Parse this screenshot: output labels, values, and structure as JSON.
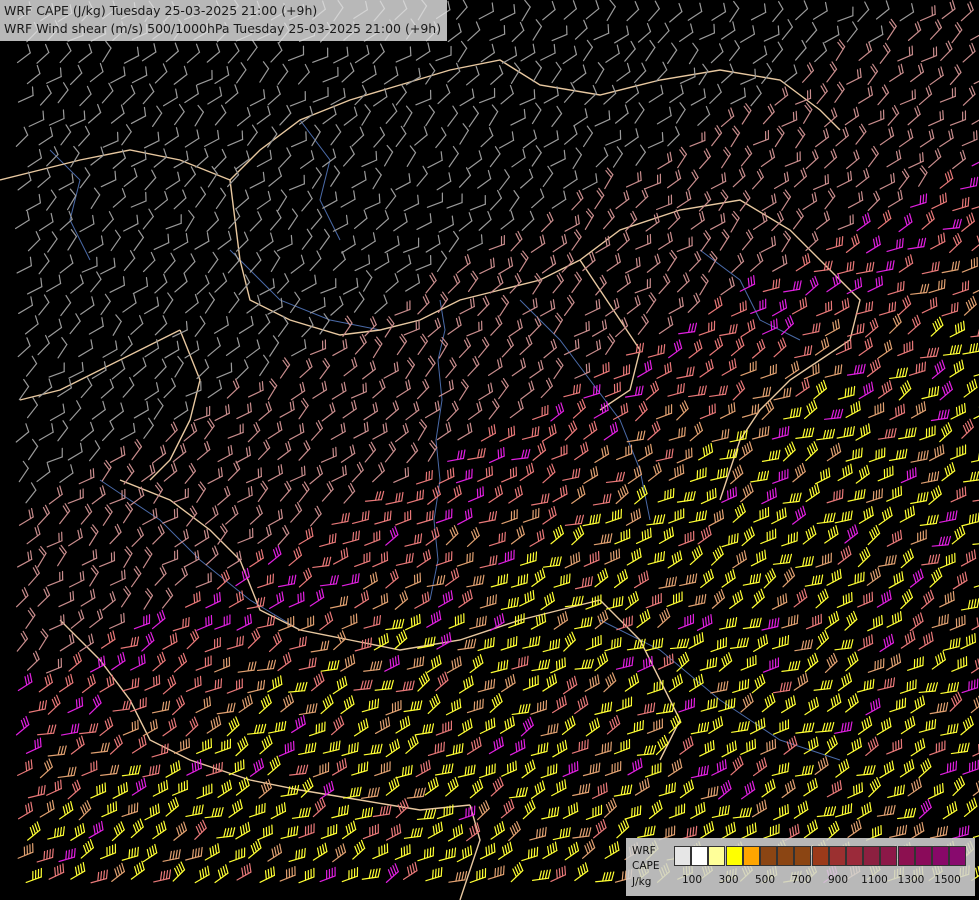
{
  "header": {
    "line1": "WRF CAPE (J/kg) Tuesday 25-03-2025 21:00 (+9h)",
    "line2": "WRF Wind shear (m/s) 500/1000hPa Tuesday 25-03-2025 21:00 (+9h)"
  },
  "legend": {
    "line1": "WRF",
    "line2": "CAPE",
    "line3": "J/kg",
    "colors": [
      "#e6e6e6",
      "#ffffff",
      "#ffff99",
      "#ffff00",
      "#ffa500",
      "#8b4513",
      "#8b4513",
      "#8b4513",
      "#9b3a1a",
      "#9b3030",
      "#9b2a3a",
      "#8c2040",
      "#8c1848",
      "#8c1050",
      "#8a0a5a",
      "#880868",
      "#880a6e"
    ],
    "ticks": [
      "100",
      "300",
      "500",
      "700",
      "900",
      "1100",
      "1300",
      "1500"
    ]
  },
  "map": {
    "background": "#000000",
    "barb_colors": {
      "low": "#9a9a9a",
      "mid": "#c88c8c",
      "high": "#e87878",
      "very_high": "#e0a070",
      "extreme": "#ffff33",
      "magenta": "#e020e0"
    },
    "border_color": "#e8c8a0",
    "river_color": "#4a6aa8"
  }
}
